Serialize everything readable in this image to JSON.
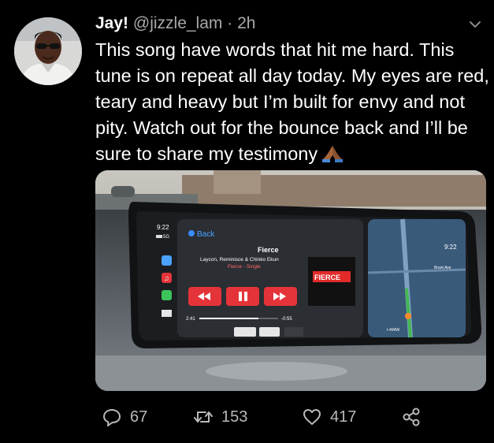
{
  "tweet": {
    "display_name": "Jay!",
    "handle": "@jizzle_lam",
    "separator": "·",
    "time": "2h",
    "text": "This song have words that hit me hard. This tune is on repeat all day today. My eyes are red, teary and heavy but I’m built for envy and not pity. Watch out for the bounce back and I’ll be sure to share my testimony",
    "emoji_icon": "folded-hands-emoji-icon"
  },
  "media": {
    "carplay": {
      "clock_left": "9:22",
      "signal": "5G",
      "back_label": "Back",
      "song_title": "Fierce",
      "artists": "Laycon, Reminisce & Chinko Ekun",
      "album": "Fierce - Single",
      "album_art_text": "FIERCE",
      "elapsed": "2:41",
      "remaining": "-0:55",
      "map_clock": "9:22",
      "road_label": "I-494W",
      "street_label": "Brant Ave",
      "progress": 0.75
    }
  },
  "actions": {
    "replies": "67",
    "retweets": "153",
    "likes": "417"
  },
  "colors": {
    "background": "#000000",
    "muted_text": "#a9a9a9",
    "action_icon": "#b9b9b9",
    "carplay_red": "#e5333a"
  }
}
